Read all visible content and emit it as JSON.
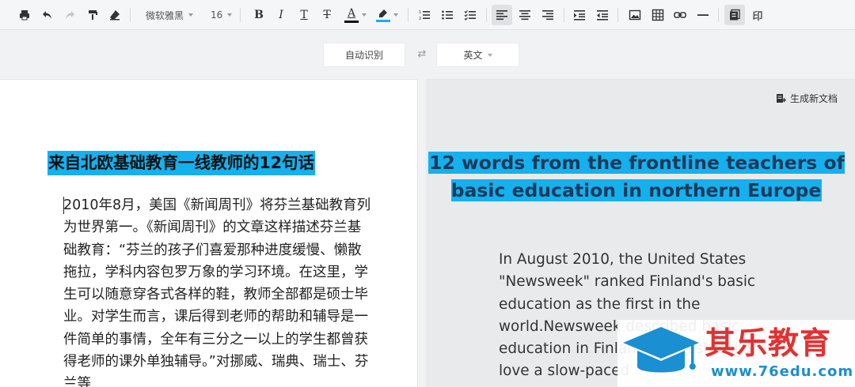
{
  "toolbar": {
    "font_family": "微软雅黑",
    "font_size": "16",
    "bold": "B",
    "italic": "I",
    "underline": "T",
    "strikethrough": "T",
    "font_color_letter": "A",
    "font_color": "#111111",
    "highlight_color": "#16b0ee",
    "print_label": "印"
  },
  "translate_bar": {
    "source_lang": "自动识别",
    "swap_icon": "⇄",
    "target_lang": "英文"
  },
  "source_doc": {
    "title": "来自北欧基础教育一线教师的12句话",
    "body": "2010年8月，美国《新闻周刊》将芬兰基础教育列为世界第一。《新闻周刊》的文章这样描述芬兰基础教育：“芬兰的孩子们喜爱那种进度缓慢、懒散拖拉，学科内容包罗万象的学习环境。在这里，学生可以随意穿各式各样的鞋，教师全部都是硕士毕业。对学生而言，课后得到老师的帮助和辅导是一件简单的事情，全年有三分之一以上的学生都曾获得老师的课外单独辅导。”对挪威、瑞典、瑞士、芬兰等"
  },
  "translated_doc": {
    "generate_label": "生成新文档",
    "title": "12 words from the frontline teachers of basic education in northern Europe",
    "body": "In August 2010, the United States \"Newsweek\" ranked Finland's basic education as the first in the world.Newsweek described basic education in Finland: \"Finnish children love a slow-paced"
  },
  "watermark": {
    "name": "其乐教育",
    "url": "www.76edu.com"
  },
  "colors": {
    "highlight": "#16b0ee",
    "brand_red": "#e03232",
    "brand_blue": "#1a8fd1"
  }
}
